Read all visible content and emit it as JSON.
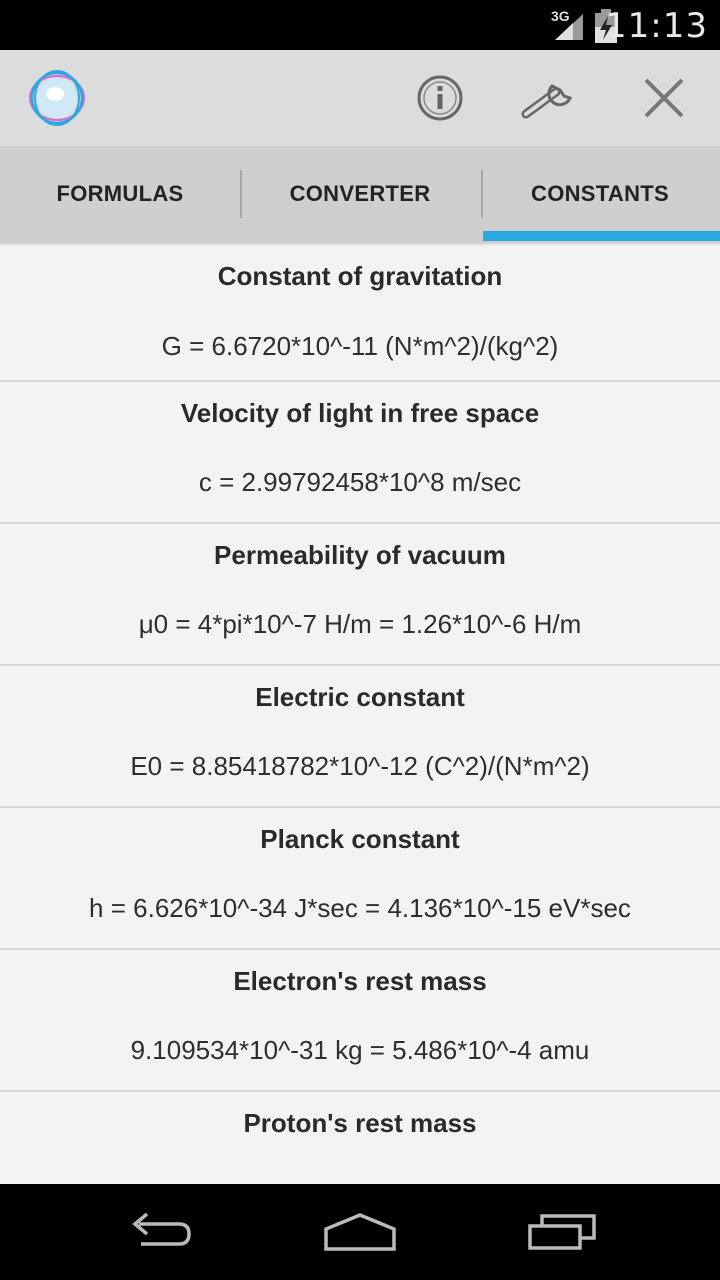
{
  "status_bar": {
    "network_type": "3G",
    "time": "11:13",
    "icons": [
      "signal-icon",
      "battery-charging-icon"
    ]
  },
  "action_bar": {
    "app_icon": "atom-app-icon",
    "actions": [
      {
        "name": "info",
        "icon": "info-icon"
      },
      {
        "name": "tools",
        "icon": "wrench-icon"
      },
      {
        "name": "close",
        "icon": "close-icon"
      }
    ]
  },
  "tabs": [
    {
      "label": "FORMULAS",
      "selected": false
    },
    {
      "label": "CONVERTER",
      "selected": false
    },
    {
      "label": "CONSTANTS",
      "selected": true
    }
  ],
  "accent_color": "#2aa9de",
  "constants": [
    {
      "title": "Constant of gravitation",
      "value": "G = 6.6720*10^-11 (N*m^2)/(kg^2)"
    },
    {
      "title": "Velocity of light in free space",
      "value": "c = 2.99792458*10^8 m/sec"
    },
    {
      "title": "Permeability of vacuum",
      "value": "μ0 = 4*pi*10^-7 H/m = 1.26*10^-6 H/m"
    },
    {
      "title": "Electric constant",
      "value": "E0 = 8.85418782*10^-12 (C^2)/(N*m^2)"
    },
    {
      "title": "Planck constant",
      "value": "h = 6.626*10^-34 J*sec = 4.136*10^-15 eV*sec"
    },
    {
      "title": "Electron's rest mass",
      "value": "9.109534*10^-31 kg = 5.486*10^-4 amu"
    },
    {
      "title": "Proton's rest mass",
      "value": ""
    }
  ],
  "nav_bar": {
    "buttons": [
      "back-icon",
      "home-icon",
      "recents-icon"
    ]
  }
}
